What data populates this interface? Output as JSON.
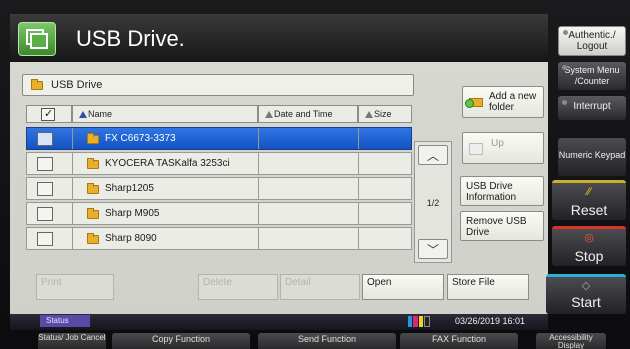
{
  "window": {
    "title": "USB Drive."
  },
  "path_bar": {
    "label": "USB Drive"
  },
  "columns": {
    "name": "Name",
    "date": "Date and Time",
    "size": "Size"
  },
  "files": [
    {
      "name": "FX C6673-3373",
      "selected": true
    },
    {
      "name": "KYOCERA TASKalfa 3253ci",
      "selected": false
    },
    {
      "name": "Sharp1205",
      "selected": false
    },
    {
      "name": "Sharp M905",
      "selected": false
    },
    {
      "name": "Sharp 8090",
      "selected": false
    }
  ],
  "pagination": {
    "page": "1/2"
  },
  "actions": {
    "add_folder": "Add a new folder",
    "up": "Up",
    "usb_info": "USB Drive Information",
    "remove_usb": "Remove USB Drive"
  },
  "bottom_actions": {
    "print": "Print",
    "delete": "Delete",
    "detail": "Detail",
    "open": "Open",
    "store_file": "Store File"
  },
  "status": {
    "label": "Status",
    "datetime": "03/26/2019  16:01",
    "toner_colors": [
      "#1e9ad8",
      "#d8287a",
      "#e8d81e",
      "#222222"
    ]
  },
  "hardware": {
    "auth": "Authentic./ Logout",
    "system_menu": "System Menu /Counter",
    "interrupt": "Interrupt",
    "keypad": "Numeric Keypad",
    "reset": "Reset",
    "stop": "Stop",
    "start": "Start"
  },
  "functions": {
    "job_cancel": "Status/ Job Cancel",
    "copy": "Copy Function",
    "send": "Send Function",
    "fax": "FAX Function",
    "accessibility": "Accessibility Display"
  },
  "colors": {
    "accent": "#1f5fd0",
    "title_bar": "#1e1e1e"
  }
}
